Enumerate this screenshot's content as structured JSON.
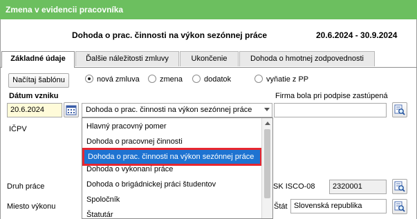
{
  "window": {
    "title": "Zmena v evidencii pracovníka"
  },
  "header": {
    "contract_title": "Dohoda o prac. činnosti na výkon sezónnej práce",
    "date_range": "20.6.2024 - 30.9.2024"
  },
  "tabs": [
    {
      "label": "Základné údaje",
      "active": true
    },
    {
      "label": "Ďalšie náležitosti zmluvy",
      "active": false
    },
    {
      "label": "Ukončenie",
      "active": false
    },
    {
      "label": "Dohoda o hmotnej zodpovednosti",
      "active": false
    }
  ],
  "toolbar": {
    "load_template_label": "Načítaj šablónu"
  },
  "contract_type_radios": [
    {
      "label": "nová zmluva",
      "selected": true
    },
    {
      "label": "zmena",
      "selected": false
    },
    {
      "label": "dodatok",
      "selected": false
    },
    {
      "label": "vyňatie z PP",
      "selected": false
    }
  ],
  "form": {
    "date_label": "Dátum vzniku",
    "date_value": "20.6.2024",
    "contract_kind_value": "Dohoda o prac. činnosti na výkon sezónnej práce",
    "company_rep_label": "Firma bola pri podpise zastúpená",
    "company_rep_value": "",
    "icpv_label": "IČPV",
    "job_type_label": "Druh práce",
    "isco_label": "SK ISCO-08",
    "isco_value": "2320001",
    "work_place_label": "Miesto výkonu",
    "state_label": "Štát",
    "state_value": "Slovenská republika"
  },
  "dropdown": {
    "items": [
      {
        "label": "Hlavný pracovný pomer",
        "selected": false
      },
      {
        "label": "Dohoda o pracovnej činnosti",
        "selected": false
      },
      {
        "label": "Dohoda o prac. činnosti na výkon sezónnej práce",
        "selected": true
      },
      {
        "label": "Dohoda o vykonaní práce",
        "selected": false
      },
      {
        "label": "Dohoda o brigádnickej práci študentov",
        "selected": false
      },
      {
        "label": "Spoločník",
        "selected": false
      },
      {
        "label": "Štatutár",
        "selected": false
      }
    ]
  },
  "colors": {
    "title_bar": "#6cbf5f",
    "date_field": "#fffbd9",
    "highlight": "#1e73d1",
    "selection_outline": "#e8262f"
  },
  "icons": {
    "calendar": "calendar-icon",
    "lookup": "search-list-icon"
  }
}
